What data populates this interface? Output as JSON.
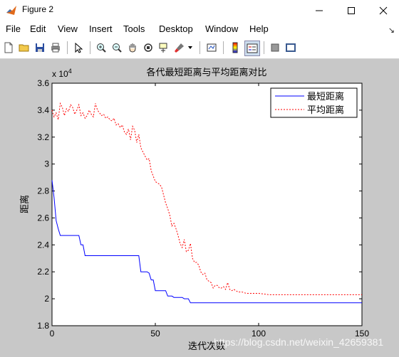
{
  "window": {
    "title": "Figure 2"
  },
  "menu": {
    "file": "File",
    "edit": "Edit",
    "view": "View",
    "insert": "Insert",
    "tools": "Tools",
    "desktop": "Desktop",
    "window": "Window",
    "help": "Help"
  },
  "toolbar": {
    "icons": [
      "new-figure-icon",
      "open-file-icon",
      "save-icon",
      "print-icon",
      "edit-plot-arrow-icon",
      "zoom-in-icon",
      "zoom-out-icon",
      "pan-hand-icon",
      "rotate-3d-icon",
      "data-cursor-icon",
      "brush-icon",
      "link-plot-icon",
      "insert-colorbar-icon",
      "insert-legend-icon",
      "hide-plot-tools-icon",
      "show-plot-tools-icon"
    ]
  },
  "watermark": "https://blog.csdn.net/weixin_42659381",
  "chart_data": {
    "type": "line",
    "title": "各代最短距离与平均距离对比",
    "xlabel": "迭代次数",
    "ylabel": "距离",
    "y_exponent_label": "x 10",
    "y_exponent": "4",
    "xlim": [
      0,
      150
    ],
    "ylim": [
      18000,
      36000
    ],
    "xticks": [
      0,
      50,
      100,
      150
    ],
    "yticks": [
      18000,
      20000,
      22000,
      24000,
      26000,
      28000,
      30000,
      32000,
      34000,
      36000
    ],
    "ytick_labels": [
      "1.8",
      "2",
      "2.2",
      "2.4",
      "2.6",
      "2.8",
      "3",
      "3.2",
      "3.4",
      "3.6"
    ],
    "legend_position": "top-right",
    "grid": false,
    "series": [
      {
        "name": "最短距离",
        "color": "#0000ff",
        "style": "solid",
        "x": [
          0,
          1,
          2,
          3,
          4,
          5,
          6,
          7,
          8,
          9,
          10,
          11,
          12,
          13,
          14,
          15,
          16,
          17,
          18,
          19,
          20,
          25,
          30,
          35,
          40,
          42,
          43,
          44,
          45,
          46,
          47,
          48,
          49,
          50,
          51,
          52,
          53,
          54,
          55,
          56,
          57,
          58,
          59,
          60,
          61,
          62,
          63,
          64,
          65,
          66,
          67,
          68,
          70,
          80,
          90,
          100,
          110,
          120,
          130,
          140,
          150
        ],
        "y": [
          28800,
          27500,
          25800,
          25200,
          24700,
          24700,
          24700,
          24700,
          24700,
          24700,
          24700,
          24700,
          24700,
          24700,
          24000,
          24000,
          23200,
          23200,
          23200,
          23200,
          23200,
          23200,
          23200,
          23200,
          23200,
          23200,
          22000,
          22000,
          22000,
          22000,
          21900,
          21400,
          21400,
          20600,
          20600,
          20600,
          20600,
          20600,
          20600,
          20200,
          20200,
          20200,
          20100,
          20100,
          20100,
          20100,
          20100,
          20000,
          20000,
          20000,
          19700,
          19700,
          19700,
          19700,
          19700,
          19700,
          19700,
          19700,
          19700,
          19700,
          19700
        ]
      },
      {
        "name": "平均距离",
        "color": "#ff0000",
        "style": "dashed",
        "x": [
          0,
          1,
          2,
          3,
          4,
          5,
          6,
          7,
          8,
          9,
          10,
          11,
          12,
          13,
          14,
          15,
          16,
          17,
          18,
          19,
          20,
          21,
          22,
          23,
          24,
          25,
          26,
          27,
          28,
          29,
          30,
          31,
          32,
          33,
          34,
          35,
          36,
          37,
          38,
          39,
          40,
          41,
          42,
          43,
          44,
          45,
          46,
          47,
          48,
          49,
          50,
          51,
          52,
          53,
          54,
          55,
          56,
          57,
          58,
          59,
          60,
          61,
          62,
          63,
          64,
          65,
          66,
          67,
          68,
          69,
          70,
          71,
          72,
          73,
          74,
          75,
          76,
          77,
          78,
          79,
          80,
          81,
          82,
          83,
          84,
          85,
          86,
          87,
          88,
          90,
          92,
          94,
          96,
          98,
          100,
          105,
          110,
          115,
          120,
          125,
          130,
          140,
          150
        ],
        "y": [
          34000,
          33500,
          33800,
          33300,
          34500,
          34200,
          33600,
          34100,
          33900,
          34400,
          34200,
          33700,
          34000,
          34400,
          33600,
          33800,
          33400,
          33600,
          34000,
          33700,
          33500,
          34500,
          34000,
          33800,
          33600,
          33700,
          33400,
          33500,
          33300,
          33200,
          33400,
          32900,
          33000,
          32700,
          32900,
          32400,
          32200,
          32600,
          31800,
          32800,
          32500,
          31600,
          32200,
          31200,
          30900,
          30600,
          30300,
          30400,
          29500,
          29100,
          28700,
          28600,
          28500,
          28300,
          27700,
          27100,
          26700,
          26200,
          25400,
          25600,
          25200,
          24700,
          24100,
          23800,
          24400,
          23500,
          23600,
          24100,
          23000,
          22700,
          22700,
          22500,
          22000,
          21800,
          21900,
          21400,
          21300,
          21200,
          20800,
          21000,
          21000,
          20800,
          20800,
          20900,
          20700,
          21200,
          20700,
          20600,
          20700,
          20500,
          20500,
          20400,
          20400,
          20400,
          20400,
          20300,
          20300,
          20300,
          20300,
          20300,
          20300,
          20300,
          20300
        ]
      }
    ]
  }
}
